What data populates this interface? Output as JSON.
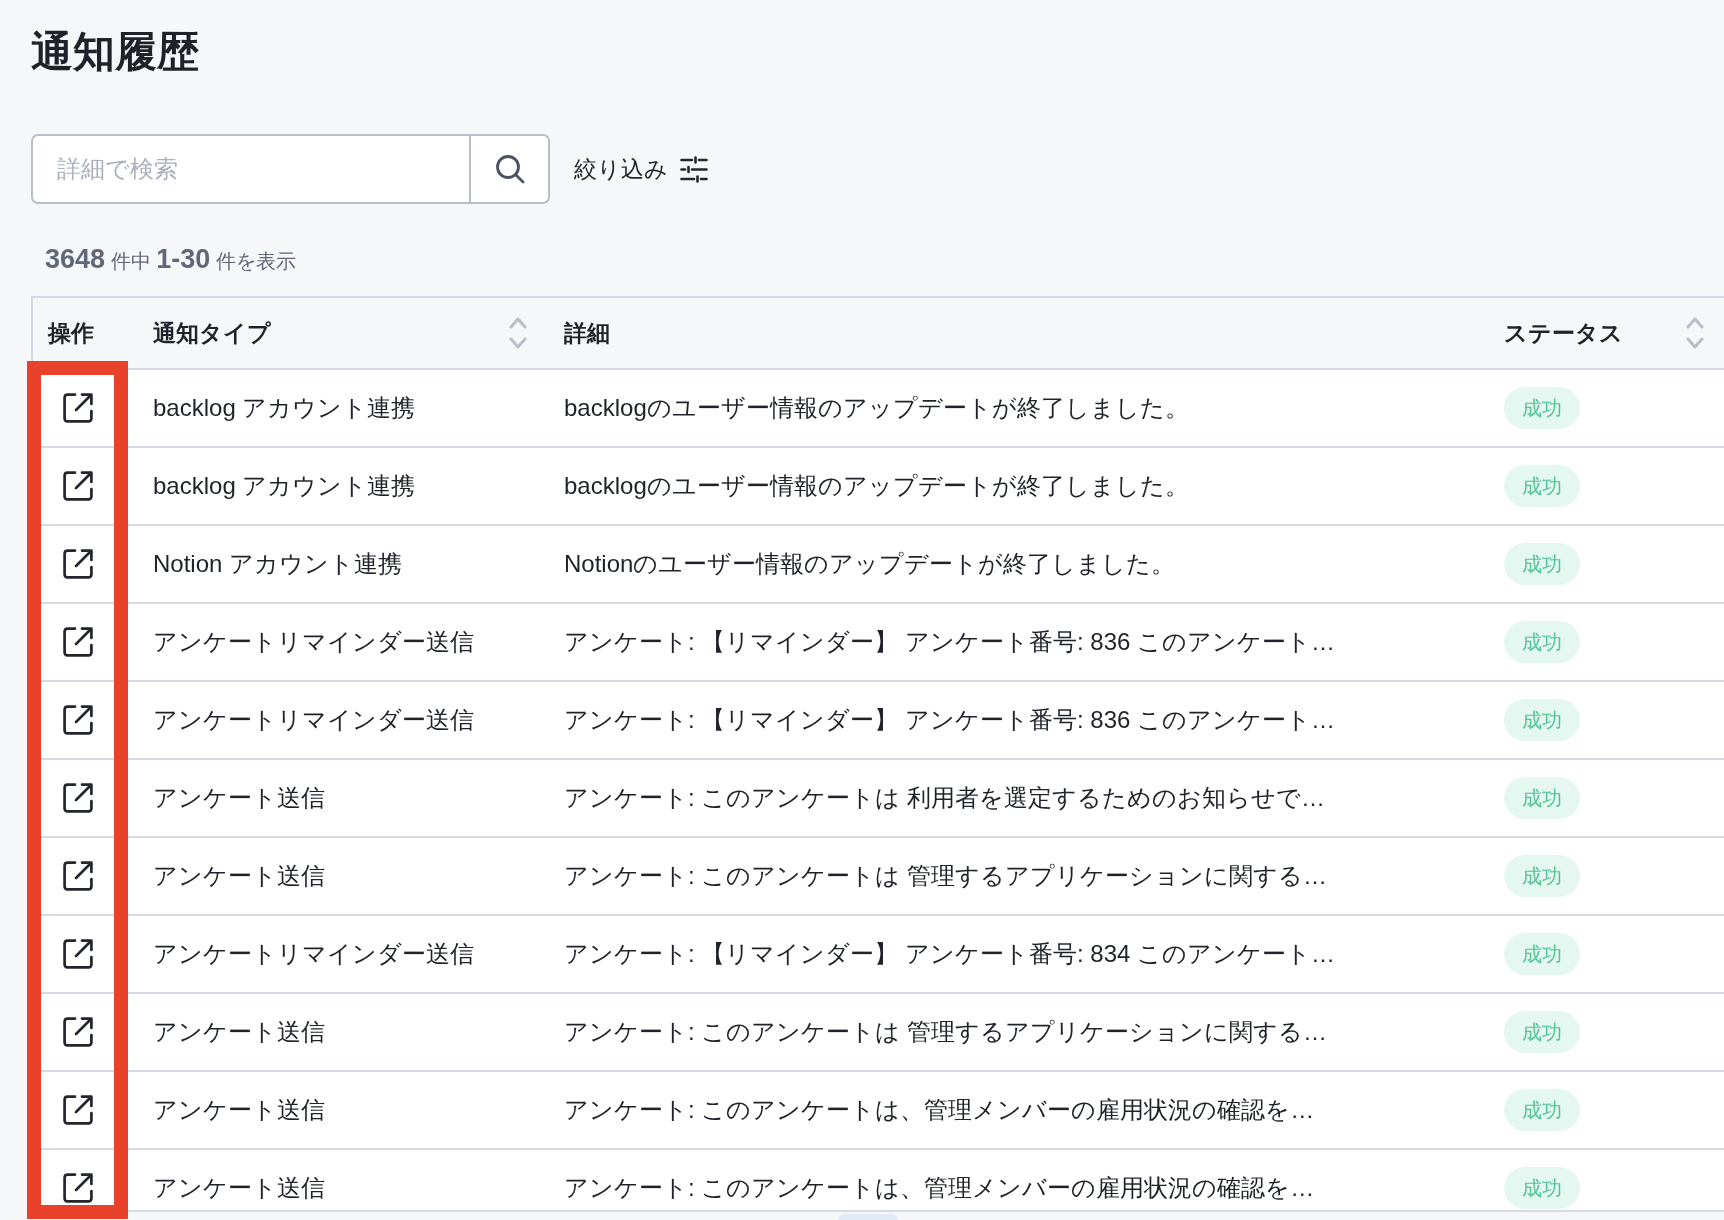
{
  "page": {
    "title": "通知履歴"
  },
  "search": {
    "placeholder": "詳細で検索"
  },
  "filter_button": {
    "label": "絞り込み"
  },
  "result_count": "**3648** 件中 **1-30** 件を表示",
  "table": {
    "highlight_actions_column": true,
    "columns": [
      {
        "label": "操作",
        "sortable": false
      },
      {
        "label": "通知タイプ",
        "sortable": true
      },
      {
        "label": "詳細",
        "sortable": false
      },
      {
        "label": "ステータス",
        "sortable": true
      }
    ],
    "rows": [
      {
        "type": "backlog アカウント連携",
        "detail": "backlogのユーザー情報のアップデートが終了しました。",
        "status": "成功"
      },
      {
        "type": "backlog アカウント連携",
        "detail": "backlogのユーザー情報のアップデートが終了しました。",
        "status": "成功"
      },
      {
        "type": "Notion アカウント連携",
        "detail": "Notionのユーザー情報のアップデートが終了しました。",
        "status": "成功"
      },
      {
        "type": "アンケートリマインダー送信",
        "detail": "アンケート: 【リマインダー】 アンケート番号: 836 このアンケート…",
        "status": "成功"
      },
      {
        "type": "アンケートリマインダー送信",
        "detail": "アンケート: 【リマインダー】 アンケート番号: 836 このアンケート…",
        "status": "成功"
      },
      {
        "type": "アンケート送信",
        "detail": "アンケート: このアンケートは 利用者を選定するためのお知らせで…",
        "status": "成功"
      },
      {
        "type": "アンケート送信",
        "detail": "アンケート: このアンケートは 管理するアプリケーションに関する…",
        "status": "成功"
      },
      {
        "type": "アンケートリマインダー送信",
        "detail": "アンケート: 【リマインダー】 アンケート番号: 834 このアンケート…",
        "status": "成功"
      },
      {
        "type": "アンケート送信",
        "detail": "アンケート: このアンケートは 管理するアプリケーションに関する…",
        "status": "成功"
      },
      {
        "type": "アンケート送信",
        "detail": "アンケート: このアンケートは、管理メンバーの雇用状況の確認を…",
        "status": "成功"
      },
      {
        "type": "アンケート送信",
        "detail": "アンケート: このアンケートは、管理メンバーの雇用状況の確認を…",
        "status": "成功"
      }
    ]
  }
}
